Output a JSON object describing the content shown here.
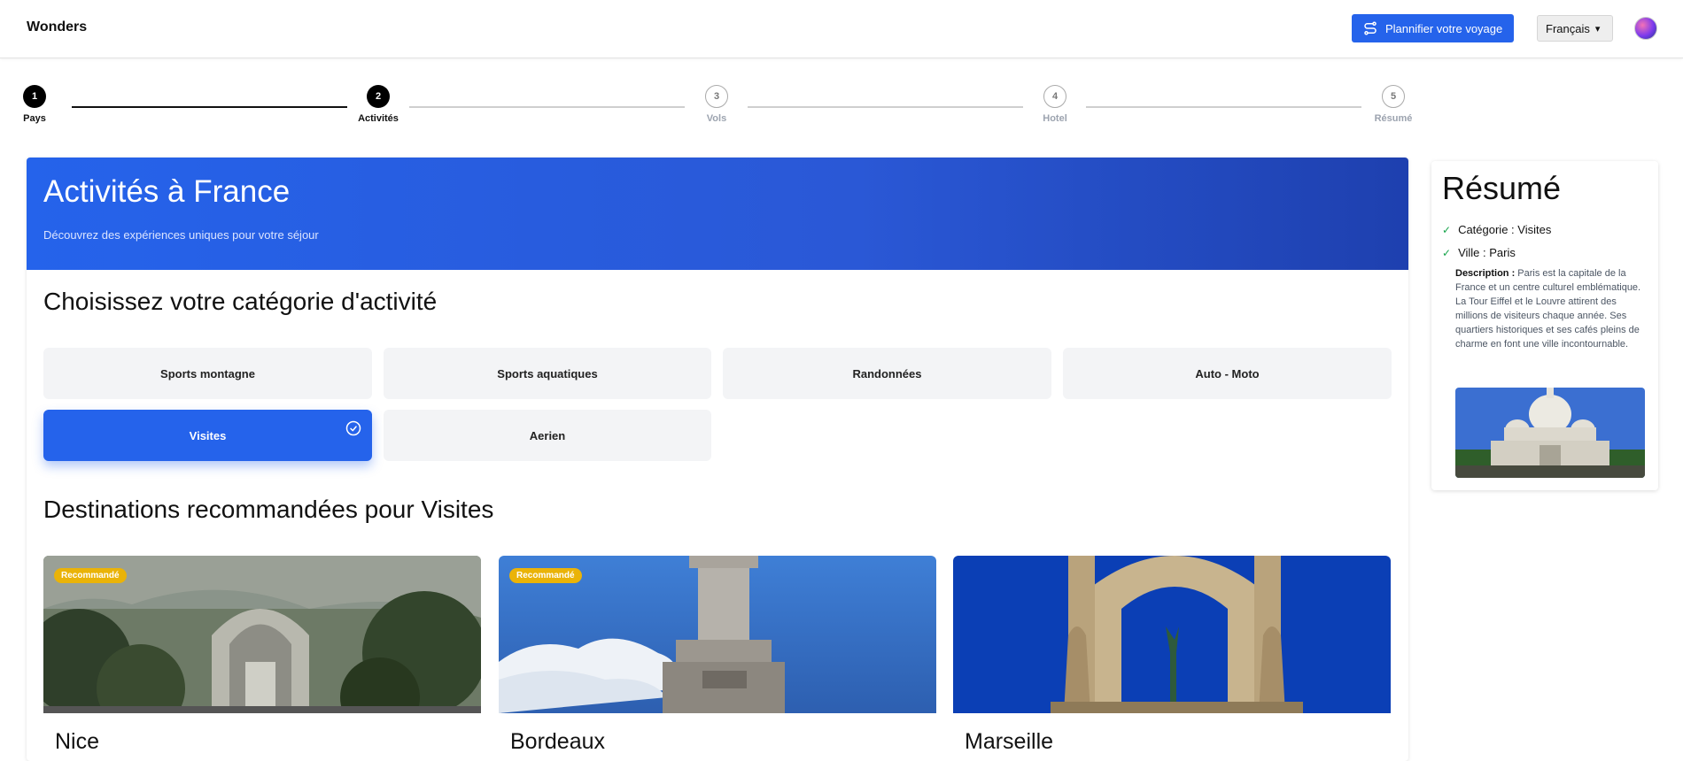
{
  "header": {
    "brand": "Wonders",
    "plan_button": "Plannifier votre voyage",
    "language": "Français"
  },
  "stepper": {
    "steps": [
      {
        "num": "1",
        "label": "Pays"
      },
      {
        "num": "2",
        "label": "Activités"
      },
      {
        "num": "3",
        "label": "Vols"
      },
      {
        "num": "4",
        "label": "Hotel"
      },
      {
        "num": "5",
        "label": "Résumé"
      }
    ]
  },
  "hero": {
    "title": "Activités à France",
    "subtitle": "Découvrez des expériences uniques pour votre séjour"
  },
  "categories": {
    "title": "Choisissez votre catégorie d'activité",
    "items": [
      "Sports montagne",
      "Sports aquatiques",
      "Randonnées",
      "Auto - Moto",
      "Visites",
      "Aerien"
    ],
    "selected": "Visites"
  },
  "destinations": {
    "title": "Destinations recommandées pour Visites",
    "cards": [
      {
        "name": "Nice",
        "badge": "Recommandé"
      },
      {
        "name": "Bordeaux",
        "badge": "Recommandé"
      },
      {
        "name": "Marseille"
      }
    ]
  },
  "summary": {
    "title": "Résumé",
    "category": "Catégorie : Visites",
    "city": "Ville : Paris",
    "desc_label": "Description :",
    "desc_text": "Paris est la capitale de la France et un centre culturel emblématique. La Tour Eiffel et le Louvre attirent des millions de visiteurs chaque année. Ses quartiers historiques et ses cafés pleins de charme en font une ville incontournable."
  },
  "colors": {
    "accent": "#2563eb",
    "badge": "#eab308",
    "check": "#16a34a"
  }
}
